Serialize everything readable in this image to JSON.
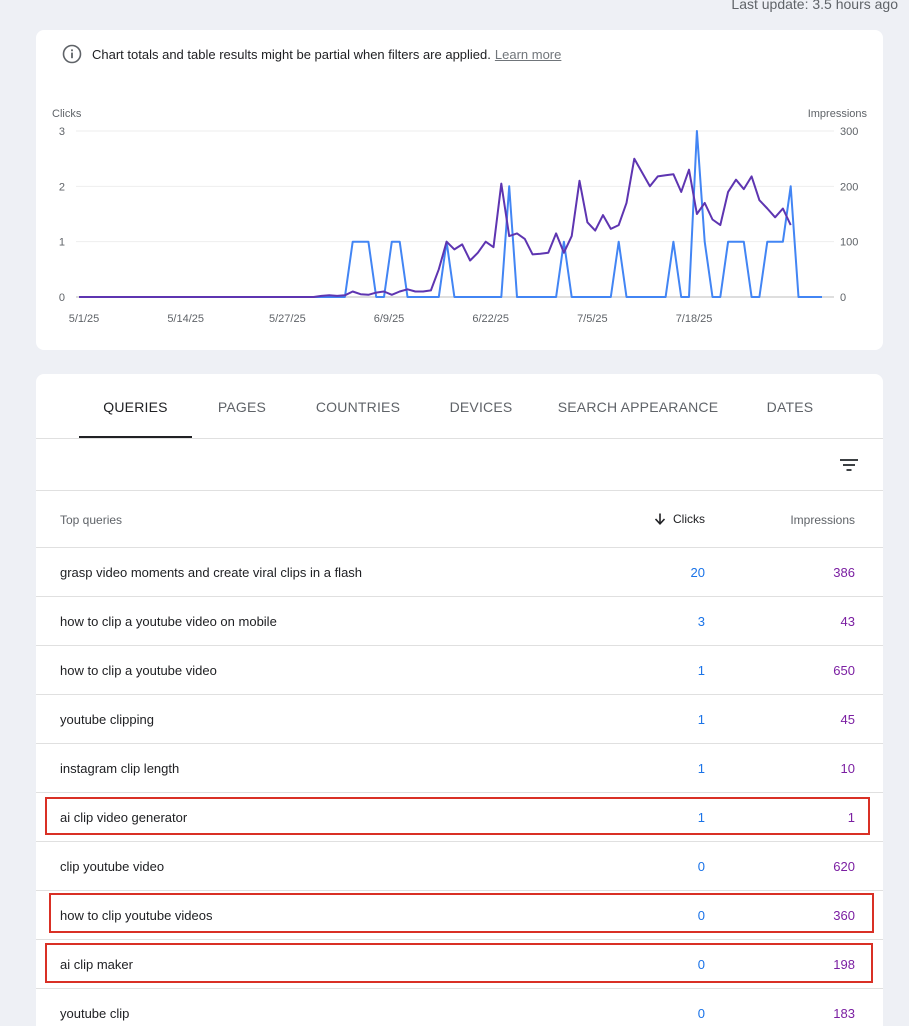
{
  "header": {
    "last_update": "Last update: 3.5 hours ago"
  },
  "notice": {
    "text": "Chart totals and table results might be partial when filters are applied.",
    "link": "Learn more",
    "icon": "info-icon"
  },
  "chart_data": {
    "type": "line",
    "left_axis_label": "Clicks",
    "right_axis_label": "Impressions",
    "left_ticks": [
      "0",
      "1",
      "2",
      "3"
    ],
    "right_ticks": [
      "0",
      "100",
      "200",
      "300"
    ],
    "ylim_left": [
      0,
      3
    ],
    "ylim_right": [
      0,
      300
    ],
    "x_tick_labels": [
      "5/1/25",
      "5/14/25",
      "5/27/25",
      "6/9/25",
      "6/22/25",
      "7/5/25",
      "7/18/25"
    ],
    "x_tick_index": [
      0,
      13,
      26,
      39,
      52,
      65,
      78
    ],
    "grid": true,
    "series": [
      {
        "name": "Clicks",
        "color": "#4285f4",
        "values": [
          0,
          0,
          0,
          0,
          0,
          0,
          0,
          0,
          0,
          0,
          0,
          0,
          0,
          0,
          0,
          0,
          0,
          0,
          0,
          0,
          0,
          0,
          0,
          0,
          0,
          0,
          0,
          0,
          0,
          0,
          0,
          0,
          0,
          0,
          0,
          1,
          1,
          1,
          0,
          0,
          1,
          1,
          0,
          0,
          0,
          0,
          0,
          1,
          0,
          0,
          0,
          0,
          0,
          0,
          0,
          2,
          0,
          0,
          0,
          0,
          0,
          0,
          1,
          0,
          0,
          0,
          0,
          0,
          0,
          1,
          0,
          0,
          0,
          0,
          0,
          0,
          1,
          0,
          0,
          3,
          1,
          0,
          0,
          1,
          1,
          1,
          0,
          0,
          1,
          1,
          1,
          2,
          0,
          0,
          0,
          0
        ]
      },
      {
        "name": "Impressions",
        "color": "#5e35b1",
        "values": [
          0,
          0,
          0,
          0,
          0,
          0,
          0,
          0,
          0,
          0,
          0,
          0,
          0,
          0,
          0,
          0,
          0,
          0,
          0,
          0,
          0,
          0,
          0,
          0,
          0,
          0,
          0,
          0,
          0,
          0,
          0,
          2,
          3,
          2,
          3,
          10,
          5,
          4,
          8,
          10,
          4,
          10,
          14,
          10,
          10,
          12,
          50,
          100,
          86,
          95,
          66,
          80,
          100,
          90,
          205,
          110,
          115,
          105,
          77,
          78,
          80,
          115,
          80,
          110,
          210,
          135,
          120,
          148,
          123,
          130,
          170,
          250,
          225,
          200,
          218,
          220,
          222,
          190,
          230,
          150,
          170,
          140,
          130,
          190,
          212,
          195,
          218,
          175,
          160,
          144,
          160,
          130
        ]
      }
    ]
  },
  "tabs": [
    "QUERIES",
    "PAGES",
    "COUNTRIES",
    "DEVICES",
    "SEARCH APPEARANCE",
    "DATES"
  ],
  "table": {
    "headers": {
      "query": "Top queries",
      "clicks": "Clicks",
      "impressions": "Impressions"
    },
    "rows": [
      {
        "query": "grasp video moments and create viral clips in a flash",
        "clicks": "20",
        "impressions": "386"
      },
      {
        "query": "how to clip a youtube video on mobile",
        "clicks": "3",
        "impressions": "43"
      },
      {
        "query": "how to clip a youtube video",
        "clicks": "1",
        "impressions": "650"
      },
      {
        "query": "youtube clipping",
        "clicks": "1",
        "impressions": "45"
      },
      {
        "query": "instagram clip length",
        "clicks": "1",
        "impressions": "10"
      },
      {
        "query": "ai clip video generator",
        "clicks": "1",
        "impressions": "1"
      },
      {
        "query": "clip youtube video",
        "clicks": "0",
        "impressions": "620"
      },
      {
        "query": "how to clip youtube videos",
        "clicks": "0",
        "impressions": "360"
      },
      {
        "query": "ai clip maker",
        "clicks": "0",
        "impressions": "198"
      },
      {
        "query": "youtube clip",
        "clicks": "0",
        "impressions": "183"
      }
    ]
  },
  "highlighted_rows": [
    5,
    7,
    8
  ],
  "colors": {
    "clicks": "#1a73e8",
    "impressions": "#7b1fa2",
    "highlight": "#d93025"
  }
}
